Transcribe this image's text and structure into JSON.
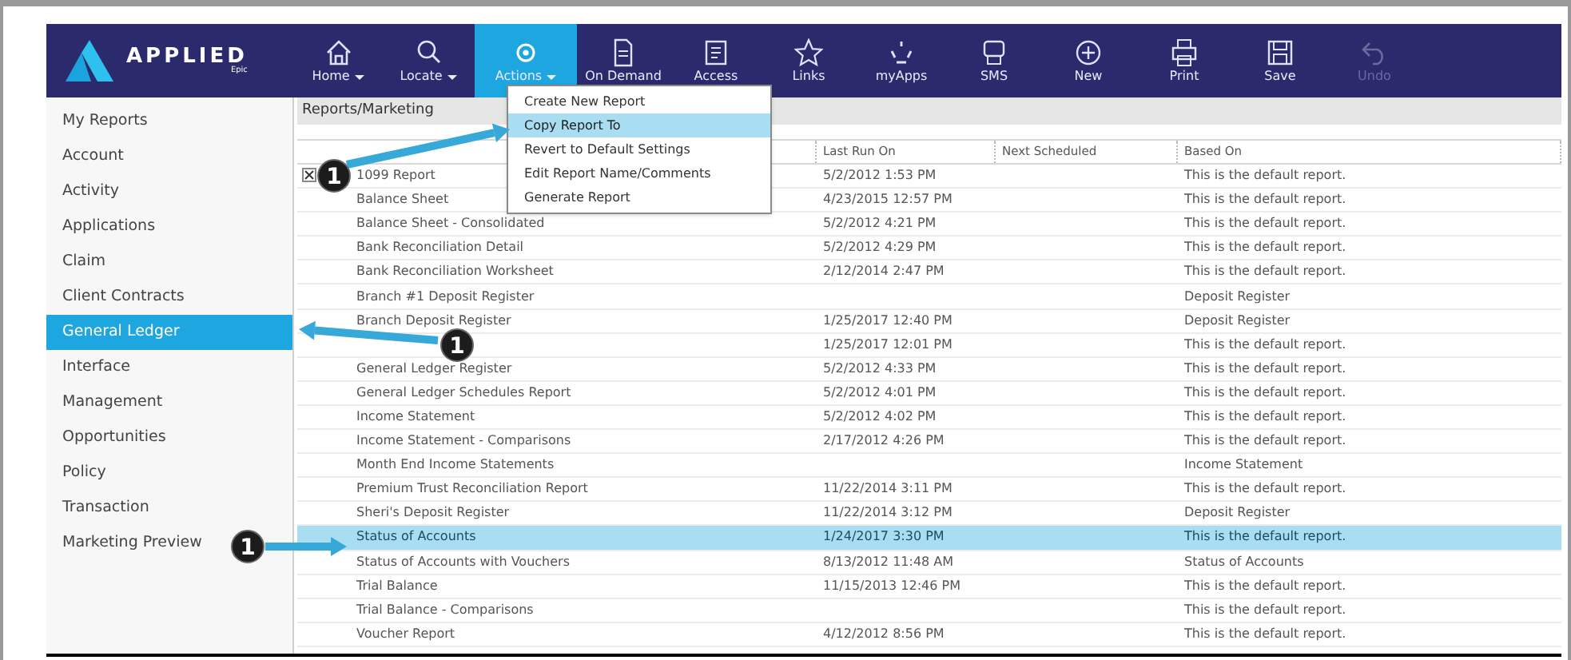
{
  "logo": {
    "name": "APPLIED",
    "sub": "Epic"
  },
  "toolbar": [
    {
      "label": "Home",
      "dropdown": true,
      "selected": false,
      "disabled": false
    },
    {
      "label": "Locate",
      "dropdown": true,
      "selected": false,
      "disabled": false
    },
    {
      "label": "Actions",
      "dropdown": true,
      "selected": true,
      "disabled": false
    },
    {
      "label": "On Demand",
      "dropdown": false,
      "selected": false,
      "disabled": false
    },
    {
      "label": "Access",
      "dropdown": false,
      "selected": false,
      "disabled": false
    },
    {
      "label": "Links",
      "dropdown": false,
      "selected": false,
      "disabled": false
    },
    {
      "label": "myApps",
      "dropdown": false,
      "selected": false,
      "disabled": false
    },
    {
      "label": "SMS",
      "dropdown": false,
      "selected": false,
      "disabled": false
    },
    {
      "label": "New",
      "dropdown": false,
      "selected": false,
      "disabled": false
    },
    {
      "label": "Print",
      "dropdown": false,
      "selected": false,
      "disabled": false
    },
    {
      "label": "Save",
      "dropdown": false,
      "selected": false,
      "disabled": false
    },
    {
      "label": "Undo",
      "dropdown": false,
      "selected": false,
      "disabled": true
    }
  ],
  "actions_menu": [
    {
      "label": "Create New Report",
      "selected": false
    },
    {
      "label": "Copy Report To",
      "selected": true
    },
    {
      "label": "Revert to Default Settings",
      "selected": false
    },
    {
      "label": "Edit Report Name/Comments",
      "selected": false
    },
    {
      "label": "Generate Report",
      "selected": false
    }
  ],
  "sidebar": {
    "items": [
      {
        "label": "My Reports",
        "selected": false
      },
      {
        "label": "Account",
        "selected": false
      },
      {
        "label": "Activity",
        "selected": false
      },
      {
        "label": "Applications",
        "selected": false
      },
      {
        "label": "Claim",
        "selected": false
      },
      {
        "label": "Client Contracts",
        "selected": false
      },
      {
        "label": "General Ledger",
        "selected": true
      },
      {
        "label": "Interface",
        "selected": false
      },
      {
        "label": "Management",
        "selected": false
      },
      {
        "label": "Opportunities",
        "selected": false
      },
      {
        "label": "Policy",
        "selected": false
      },
      {
        "label": "Transaction",
        "selected": false
      },
      {
        "label": "Marketing Preview",
        "selected": false
      }
    ]
  },
  "breadcrumb": "Reports/Marketing",
  "table": {
    "columns": [
      "Last Run On",
      "Next Scheduled",
      "Based On"
    ],
    "rows": [
      {
        "name": "1099 Report",
        "last_run": "5/2/2012 1:53 PM",
        "based_on": "This is the default report.",
        "selected": false
      },
      {
        "name": "Balance Sheet",
        "last_run": "4/23/2015 12:57 PM",
        "based_on": "This is the default report.",
        "selected": false
      },
      {
        "name": "Balance Sheet - Consolidated",
        "last_run": "5/2/2012 4:21 PM",
        "based_on": "This is the default report.",
        "selected": false
      },
      {
        "name": "Bank Reconciliation Detail",
        "last_run": "5/2/2012 4:29 PM",
        "based_on": "This is the default report.",
        "selected": false
      },
      {
        "name": "Bank Reconciliation Worksheet",
        "last_run": "2/12/2014 2:47 PM",
        "based_on": "This is the default report.",
        "selected": false
      },
      {
        "name": "Branch #1 Deposit Register",
        "last_run": "",
        "based_on": "Deposit Register",
        "selected": false
      },
      {
        "name": "Branch Deposit Register",
        "last_run": "1/25/2017 12:40 PM",
        "based_on": "Deposit Register",
        "selected": false
      },
      {
        "name": "",
        "last_run": "1/25/2017 12:01 PM",
        "based_on": "This is the default report.",
        "selected": false
      },
      {
        "name": "General Ledger Register",
        "last_run": "5/2/2012 4:33 PM",
        "based_on": "This is the default report.",
        "selected": false
      },
      {
        "name": "General Ledger Schedules Report",
        "last_run": "5/2/2012 4:01 PM",
        "based_on": "This is the default report.",
        "selected": false
      },
      {
        "name": "Income Statement",
        "last_run": "5/2/2012 4:02 PM",
        "based_on": "This is the default report.",
        "selected": false
      },
      {
        "name": "Income Statement - Comparisons",
        "last_run": "2/17/2012 4:26 PM",
        "based_on": "This is the default report.",
        "selected": false
      },
      {
        "name": "Month End Income Statements",
        "last_run": "",
        "based_on": "Income Statement",
        "selected": false
      },
      {
        "name": "Premium Trust Reconciliation Report",
        "last_run": "11/22/2014 3:11 PM",
        "based_on": "This is the default report.",
        "selected": false
      },
      {
        "name": "Sheri's Deposit Register",
        "last_run": "11/22/2014 3:12 PM",
        "based_on": "Deposit Register",
        "selected": false
      },
      {
        "name": "Status of Accounts",
        "last_run": "1/24/2017 3:30 PM",
        "based_on": "This is the default report.",
        "selected": true
      },
      {
        "name": "Status of Accounts with Vouchers",
        "last_run": "8/13/2012 11:48 AM",
        "based_on": "Status of Accounts",
        "selected": false
      },
      {
        "name": "Trial Balance",
        "last_run": "11/15/2013 12:46 PM",
        "based_on": "This is the default report.",
        "selected": false
      },
      {
        "name": "Trial Balance - Comparisons",
        "last_run": "",
        "based_on": "This is the default report.",
        "selected": false
      },
      {
        "name": "Voucher Report",
        "last_run": "4/12/2012 8:56 PM",
        "based_on": "This is the default report.",
        "selected": false
      }
    ]
  },
  "callouts": [
    {
      "label": "1"
    },
    {
      "label": "1"
    },
    {
      "label": "1"
    }
  ]
}
